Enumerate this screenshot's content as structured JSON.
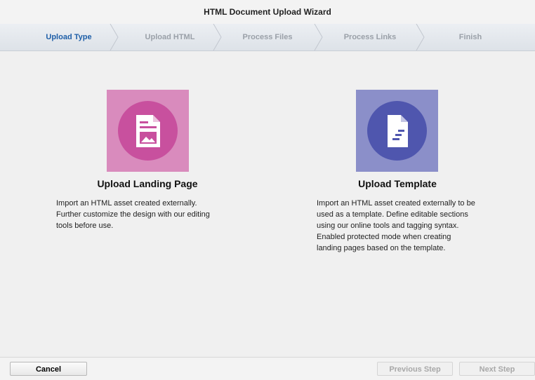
{
  "window": {
    "title": "HTML Document Upload Wizard"
  },
  "steps": [
    {
      "label": "Upload Type",
      "active": true
    },
    {
      "label": "Upload HTML",
      "active": false
    },
    {
      "label": "Process Files",
      "active": false
    },
    {
      "label": "Process Links",
      "active": false
    },
    {
      "label": "Finish",
      "active": false
    }
  ],
  "options": [
    {
      "title": "Upload Landing Page",
      "icon": "landing-page-image-icon",
      "tile_color": "#d98bbd",
      "circle_color": "#c8509e",
      "description_lines": [
        "Import an HTML asset created externally.",
        "Further customize the design with our editing",
        "tools before use."
      ]
    },
    {
      "title": "Upload Template",
      "icon": "template-document-icon",
      "tile_color": "#8b8fc9",
      "circle_color": "#4f56ae",
      "description_lines": [
        "Import an HTML asset created externally to be",
        "used as a template. Define editable sections",
        "using our online tools and tagging syntax.",
        "Enabled protected mode when creating",
        "landing pages based on the template."
      ]
    }
  ],
  "footer": {
    "cancel_label": "Cancel",
    "previous_label": "Previous Step",
    "next_label": "Next Step"
  }
}
